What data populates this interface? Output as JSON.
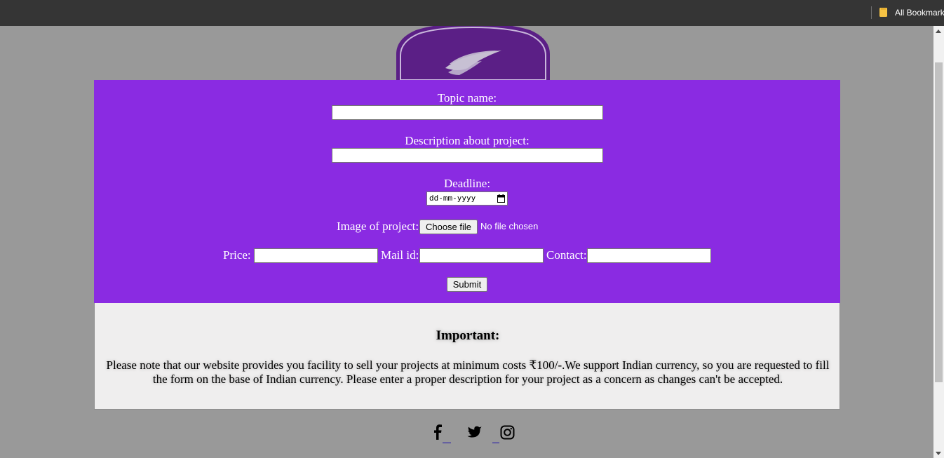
{
  "browser": {
    "bookmarks_label": "All Bookmarks",
    "folder_icon": "bookmark-folder-icon"
  },
  "logo": {
    "icon": "wing-logo-icon",
    "color": "#5b1f86"
  },
  "form": {
    "background": "#8a2be2",
    "topic_label": "Topic name:",
    "topic_value": "",
    "description_label": "Description about project:",
    "description_value": "",
    "deadline_label": "Deadline:",
    "deadline_placeholder": "dd-mm-yyyy",
    "image_label": "Image of project:",
    "file_button": "Choose file",
    "file_status": "No file chosen",
    "price_label": "Price:",
    "price_value": "",
    "mail_label": "Mail id:",
    "mail_value": "",
    "contact_label": "Contact:",
    "contact_value": "",
    "submit_label": "Submit"
  },
  "notice": {
    "heading": "Important:",
    "text": "Please note that our website provides you facility to sell your projects at minimum costs ₹100/-.We support Indian currency, so you are requested to fill the form on the base of Indian currency. Please enter a proper description for your project as a concern as changes can't be accepted."
  },
  "social": {
    "icons": [
      "facebook-icon",
      "twitter-icon",
      "instagram-icon"
    ]
  }
}
